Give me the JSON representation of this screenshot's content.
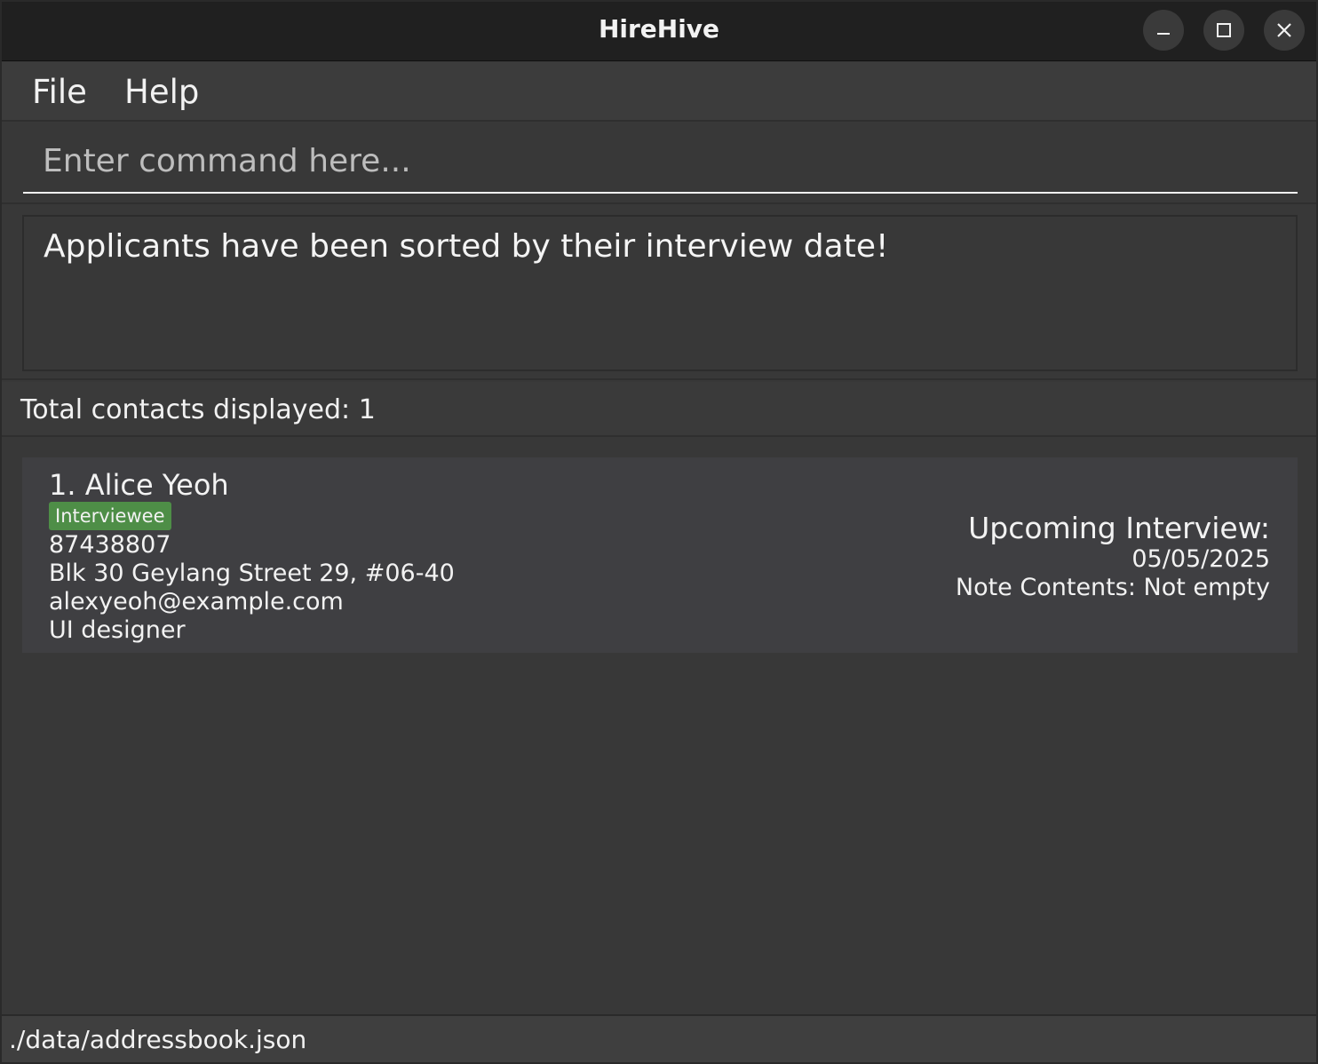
{
  "window": {
    "title": "HireHive",
    "controls": [
      "minimize-icon",
      "maximize-icon",
      "close-icon"
    ]
  },
  "menu": {
    "file_label": "File",
    "help_label": "Help"
  },
  "command": {
    "placeholder": "Enter command here...",
    "value": ""
  },
  "result": {
    "message": "Applicants have been sorted by their interview date!"
  },
  "contacts": {
    "count_text": "Total contacts displayed: 1",
    "items": [
      {
        "name": "1. Alice Yeoh",
        "tag": "Interviewee",
        "phone": "87438807",
        "address": "Blk 30 Geylang Street 29, #06-40",
        "email": "alexyeoh@example.com",
        "role": "UI designer",
        "interview_heading": "Upcoming Interview:",
        "interview_date": "05/05/2025",
        "note_status": "Note Contents: Not empty"
      }
    ]
  },
  "status": {
    "file_path": "./data/addressbook.json"
  },
  "colors": {
    "background": "#383838",
    "titlebar": "#202020",
    "card": "#3f3f42",
    "tag": "#4e8e47",
    "text": "#f2f2f2"
  }
}
